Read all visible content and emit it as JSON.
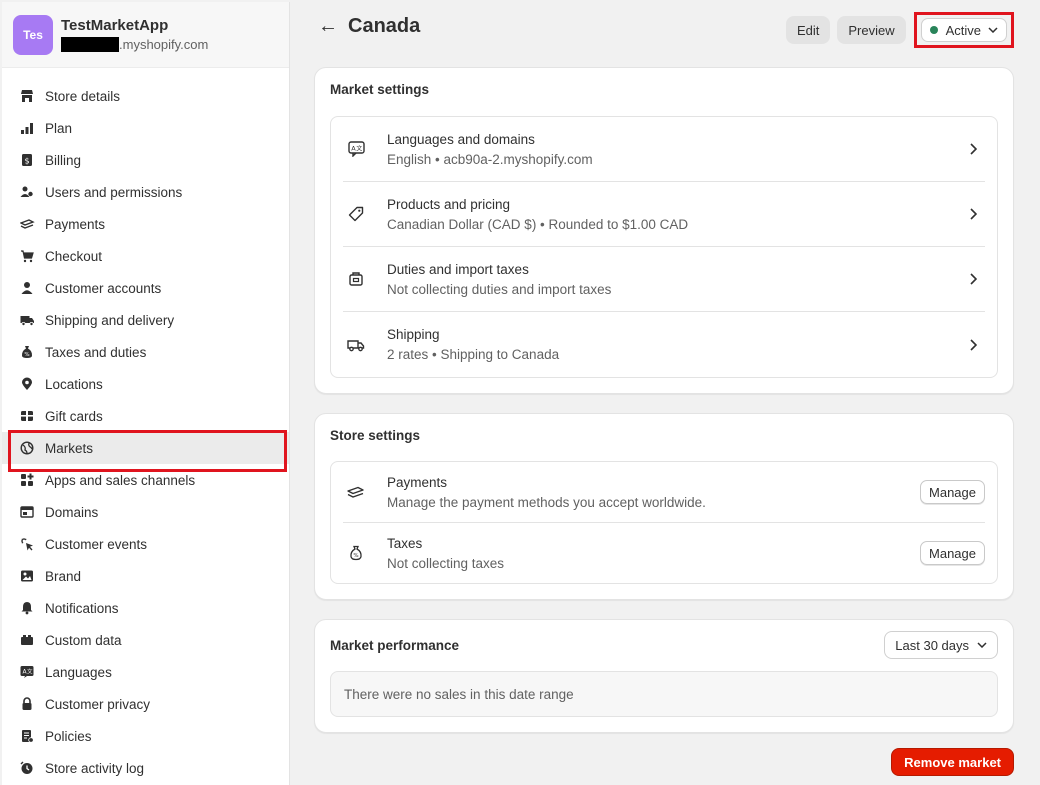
{
  "store": {
    "avatar": "Tes",
    "name": "TestMarketApp",
    "url_suffix": ".myshopify.com"
  },
  "nav": [
    {
      "label": "Store details",
      "icon": "store-icon"
    },
    {
      "label": "Plan",
      "icon": "plan-icon"
    },
    {
      "label": "Billing",
      "icon": "billing-icon"
    },
    {
      "label": "Users and permissions",
      "icon": "users-icon"
    },
    {
      "label": "Payments",
      "icon": "payments-icon"
    },
    {
      "label": "Checkout",
      "icon": "cart-icon"
    },
    {
      "label": "Customer accounts",
      "icon": "person-icon"
    },
    {
      "label": "Shipping and delivery",
      "icon": "truck-icon"
    },
    {
      "label": "Taxes and duties",
      "icon": "tax-bag-icon"
    },
    {
      "label": "Locations",
      "icon": "location-pin-icon"
    },
    {
      "label": "Gift cards",
      "icon": "gift-card-icon"
    },
    {
      "label": "Markets",
      "icon": "globe-icon",
      "active": true
    },
    {
      "label": "Apps and sales channels",
      "icon": "apps-icon"
    },
    {
      "label": "Domains",
      "icon": "domains-icon"
    },
    {
      "label": "Customer events",
      "icon": "cursor-click-icon"
    },
    {
      "label": "Brand",
      "icon": "brand-icon"
    },
    {
      "label": "Notifications",
      "icon": "bell-icon"
    },
    {
      "label": "Custom data",
      "icon": "custom-data-icon"
    },
    {
      "label": "Languages",
      "icon": "language-icon"
    },
    {
      "label": "Customer privacy",
      "icon": "lock-icon"
    },
    {
      "label": "Policies",
      "icon": "policy-icon"
    },
    {
      "label": "Store activity log",
      "icon": "activity-log-icon"
    }
  ],
  "header": {
    "title": "Canada",
    "edit_label": "Edit",
    "preview_label": "Preview",
    "status_label": "Active",
    "status_color": "#29845a"
  },
  "market_settings": {
    "title": "Market settings",
    "rows": [
      {
        "title": "Languages and domains",
        "subtitle": "English • acb90a-2.myshopify.com"
      },
      {
        "title": "Products and pricing",
        "subtitle": "Canadian Dollar (CAD $) • Rounded to $1.00 CAD"
      },
      {
        "title": "Duties and import taxes",
        "subtitle": "Not collecting duties and import taxes"
      },
      {
        "title": "Shipping",
        "subtitle": "2 rates • Shipping to Canada"
      }
    ]
  },
  "store_settings": {
    "title": "Store settings",
    "rows": [
      {
        "title": "Payments",
        "subtitle": "Manage the payment methods you accept worldwide.",
        "button": "Manage"
      },
      {
        "title": "Taxes",
        "subtitle": "Not collecting taxes",
        "button": "Manage"
      }
    ]
  },
  "performance": {
    "title": "Market performance",
    "range_label": "Last 30 days",
    "empty_text": "There were no sales in this date range"
  },
  "remove_label": "Remove market"
}
